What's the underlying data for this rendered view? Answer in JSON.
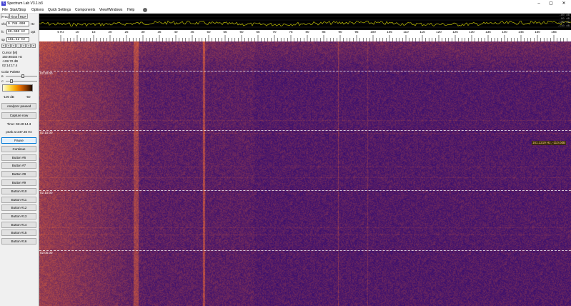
{
  "window": {
    "title": "Spectrum Lab V3.1.b3",
    "minimize": "–",
    "maximize": "▢",
    "close": "✕"
  },
  "menu": [
    "File",
    "Start/Stop",
    "Options",
    "Quick Settings",
    "Components",
    "View/Windows",
    "Help"
  ],
  "tabs": [
    "Freq",
    "Time",
    "RDF"
  ],
  "fields": [
    {
      "label": "vfo",
      "value": "0.788.000",
      "unit": "Hz"
    },
    {
      "label": "fc",
      "value": "80.600 Hz",
      "unit": "opt"
    },
    {
      "label": "sp",
      "value": "161.22 Hz",
      "unit": ""
    }
  ],
  "arrows": [
    "«",
    "<",
    "<",
    "-",
    ">",
    ">",
    "»"
  ],
  "cursor_info": {
    "title": "Cursor [M]",
    "freq": "160.98434 Hz",
    "level": "-108.72 dB",
    "time": "02:14:17.4"
  },
  "color_palette": {
    "label": "Color Palette",
    "slider_b": "B",
    "slider_c": "C",
    "low": "-100 dB",
    "high": "-50"
  },
  "buttons": {
    "analyzer": "Analyzer paused",
    "capture": "Capture now",
    "time_text": "Time: 06:40:14.3",
    "peak_text": "peak at 247.36 Hz",
    "pause": "Pause",
    "continue": "Continue",
    "list": [
      "Button #6",
      "Button #7",
      "Button #8",
      "Button #9",
      "Button #10",
      "Button #11",
      "Button #12",
      "Button #13",
      "Button #14",
      "Button #15",
      "Button #16"
    ]
  },
  "scope_levels": [
    "-80 dB",
    "-90 dB",
    "-100 dB",
    "-110 dB"
  ],
  "freq_ticks": [
    "5 Hz",
    "10",
    "15",
    "20",
    "25",
    "30",
    "35",
    "40",
    "45",
    "50",
    "55",
    "60",
    "65",
    "70",
    "75",
    "80",
    "85",
    "90",
    "95",
    "100",
    "105",
    "110",
    "115",
    "120",
    "125",
    "130",
    "135",
    "140",
    "145",
    "150",
    "155"
  ],
  "time_marks": [
    "02:20:00",
    "02:15:00",
    "02:10:00",
    "02:05:00"
  ],
  "marker_text": "161.1219 Hz, -110.0dB",
  "colors": {
    "waterfall_base": "#3c106e",
    "waterfall_hot": "#d96a1e",
    "scope_trace": "#d8d800"
  }
}
